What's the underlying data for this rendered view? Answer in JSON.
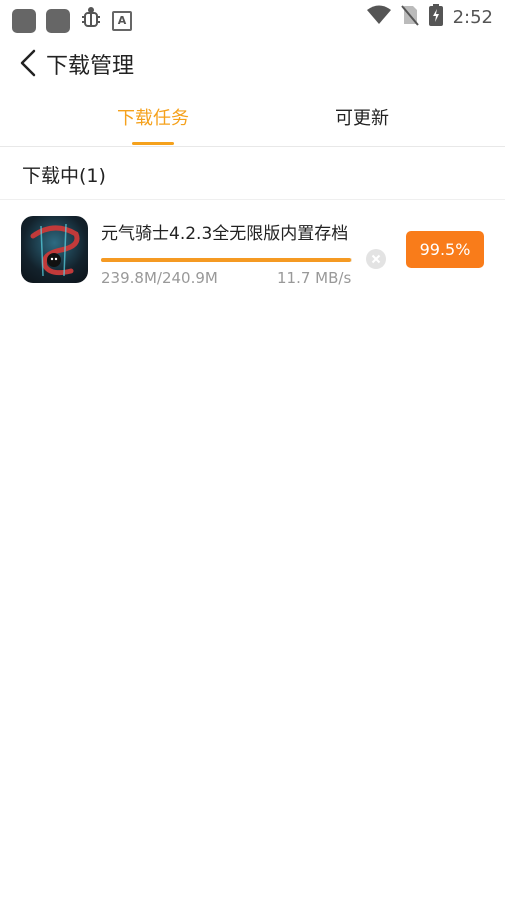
{
  "status_bar": {
    "time": "2:52",
    "icons": [
      "app-icon",
      "app-icon",
      "bug-icon",
      "a-icon",
      "wifi-icon",
      "no-sim-icon",
      "battery-charging-icon"
    ]
  },
  "header": {
    "title": "下载管理",
    "back_icon": "back-icon"
  },
  "tabs": [
    {
      "label": "下载任务",
      "active": true
    },
    {
      "label": "可更新",
      "active": false
    }
  ],
  "section": {
    "title": "下载中(1)"
  },
  "downloads": [
    {
      "name": "元气骑士4.2.3全无限版内置存档",
      "size": "239.8M/240.9M",
      "speed": "11.7 MB/s",
      "progress_percent": 99.5,
      "progress_label": "99.5%"
    }
  ],
  "colors": {
    "accent": "#f5a11c",
    "button": "#f97c1a",
    "progress": "#f59a23"
  }
}
